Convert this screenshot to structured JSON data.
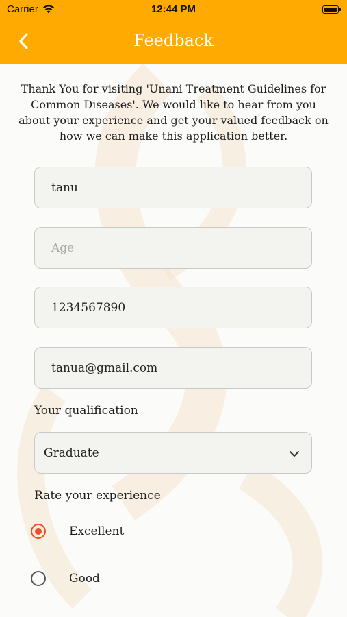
{
  "status_bar": {
    "carrier": "Carrier",
    "time": "12:44 PM"
  },
  "nav": {
    "title": "Feedback",
    "back_icon": "chevron-left-icon"
  },
  "intro_text": "Thank You for visiting 'Unani Treatment Guidelines for Common Diseases'. We would like to hear from you about your experience and get your valued feedback on how we can make this application better.",
  "form": {
    "name": {
      "value": "tanu",
      "placeholder": ""
    },
    "age": {
      "value": "",
      "placeholder": "Age"
    },
    "phone": {
      "value": "1234567890",
      "placeholder": ""
    },
    "email": {
      "value": "tanua@gmail.com",
      "placeholder": ""
    },
    "qualification_label": "Your qualification",
    "qualification_value": "Graduate",
    "rating_label": "Rate your experience",
    "rating_options": [
      {
        "label": "Excellent",
        "selected": true
      },
      {
        "label": "Good",
        "selected": false
      }
    ]
  },
  "colors": {
    "header": "#ffaa00",
    "radio_selected": "#f04e23"
  }
}
